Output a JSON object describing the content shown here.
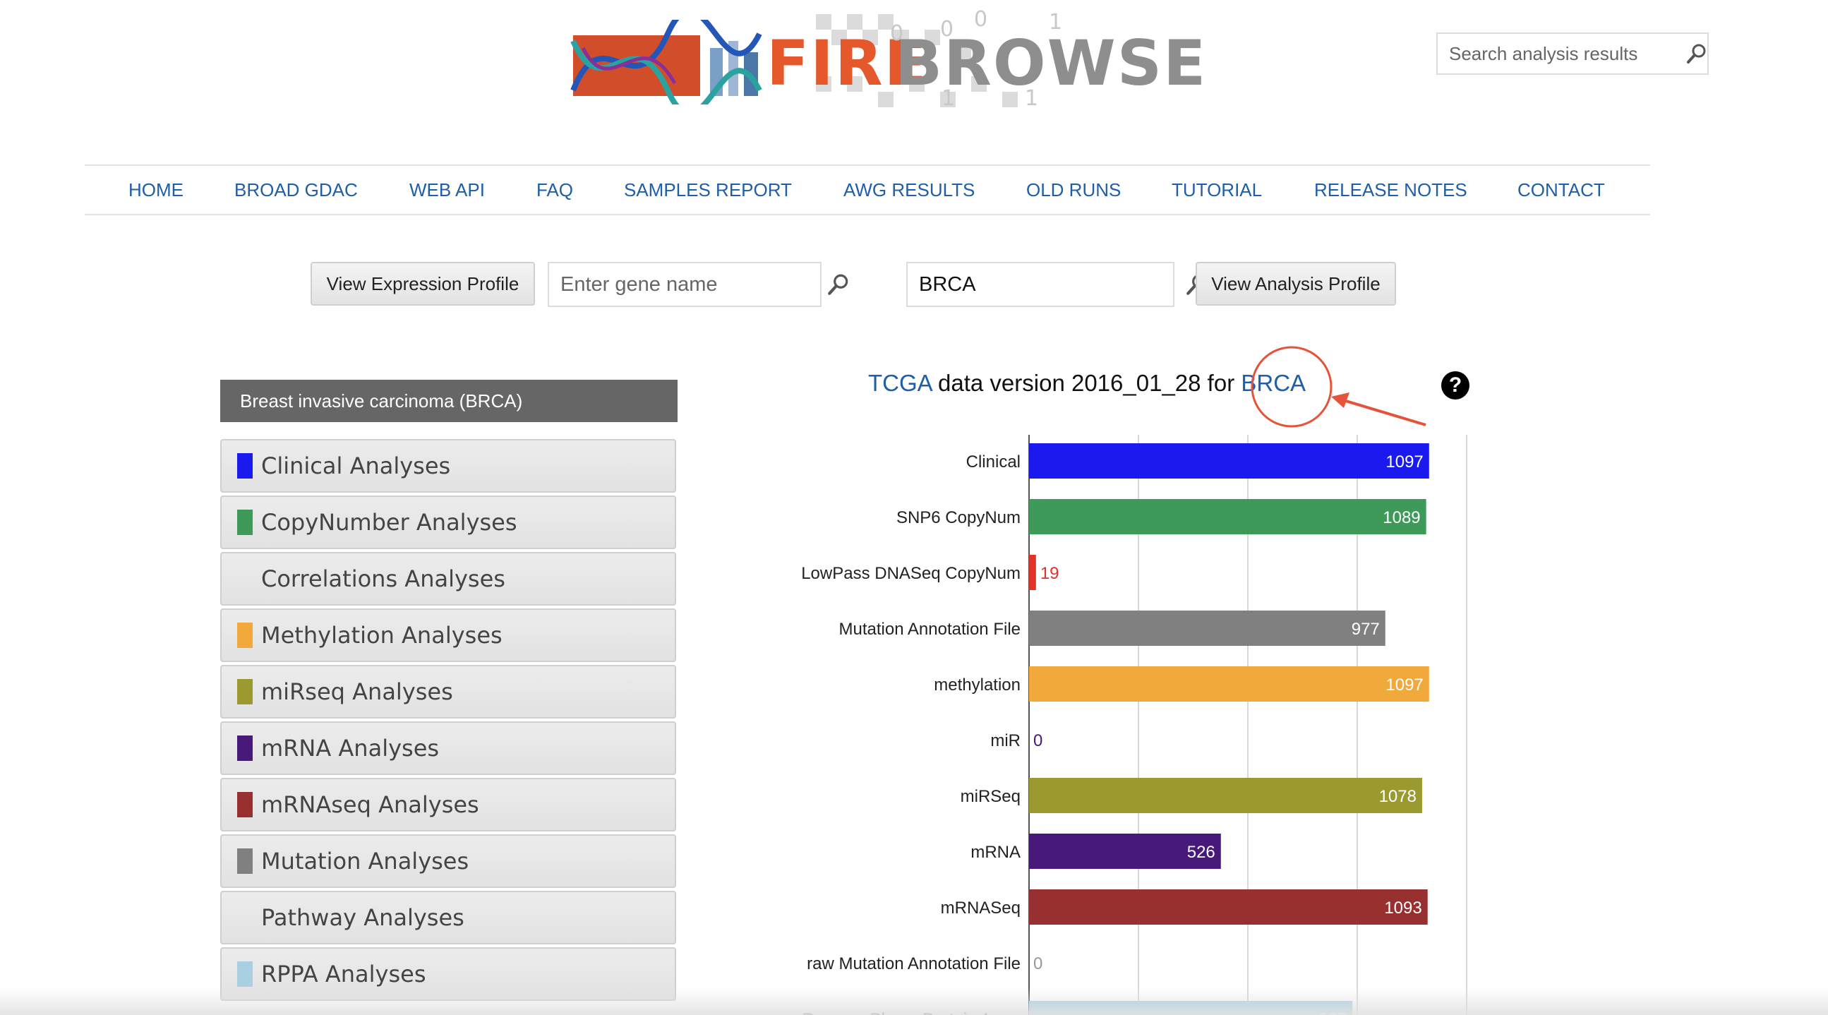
{
  "header": {
    "logo_part1": "FIRE",
    "logo_part2": "BROWSE",
    "logo_digits": [
      "0",
      "1",
      "0",
      "0",
      "1",
      "1",
      "0"
    ],
    "search_placeholder": "Search analysis results"
  },
  "nav": {
    "items": [
      "HOME",
      "BROAD GDAC",
      "WEB API",
      "FAQ",
      "SAMPLES REPORT",
      "AWG RESULTS",
      "OLD RUNS",
      "TUTORIAL",
      "RELEASE NOTES",
      "CONTACT"
    ]
  },
  "tools": {
    "expression_button": "View Expression Profile",
    "gene_placeholder": "Enter gene name",
    "cohort_value": "BRCA",
    "analysis_button": "View Analysis Profile"
  },
  "sidebar": {
    "cohort_title": "Breast invasive carcinoma (BRCA)",
    "items": [
      {
        "label": "Clinical Analyses",
        "color": "#1a1aef"
      },
      {
        "label": "CopyNumber Analyses",
        "color": "#3e9a59"
      },
      {
        "label": "Correlations Analyses",
        "color": ""
      },
      {
        "label": "Methylation Analyses",
        "color": "#f2a93b"
      },
      {
        "label": "miRseq Analyses",
        "color": "#9a9a30"
      },
      {
        "label": "mRNA Analyses",
        "color": "#46197a"
      },
      {
        "label": "mRNAseq Analyses",
        "color": "#993030"
      },
      {
        "label": "Mutation Analyses",
        "color": "#808080"
      },
      {
        "label": "Pathway Analyses",
        "color": ""
      },
      {
        "label": "RPPA Analyses",
        "color": "#a9cfe0"
      }
    ]
  },
  "chart_title": {
    "prefix_link": "TCGA",
    "middle": " data version 2016_01_28 for ",
    "cohort_link": "BRCA"
  },
  "help_icon": "?",
  "chart_data": {
    "type": "bar",
    "orientation": "horizontal",
    "categories": [
      "Clinical",
      "SNP6 CopyNum",
      "LowPass DNASeq CopyNum",
      "Mutation Annotation File",
      "methylation",
      "miR",
      "miRSeq",
      "mRNA",
      "mRNASeq",
      "raw Mutation Annotation File",
      "Reverse Phase Protein Array"
    ],
    "values": [
      1097,
      1089,
      19,
      977,
      1097,
      0,
      1078,
      526,
      1093,
      0,
      887
    ],
    "colors": [
      "#1a1aef",
      "#3e9a59",
      "#e0332a",
      "#808080",
      "#f2a93b",
      "#46197a",
      "#9a9a30",
      "#46197a",
      "#993030",
      "#808080",
      "#a9cfe0"
    ],
    "xlim": [
      0,
      1200
    ],
    "grid": true
  }
}
